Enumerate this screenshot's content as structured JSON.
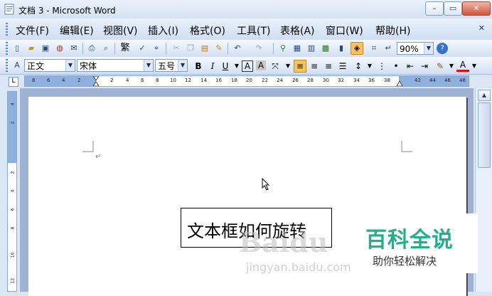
{
  "window": {
    "title": "文档 3 - Microsoft Word"
  },
  "menus": [
    "文件(F)",
    "编辑(E)",
    "视图(V)",
    "插入(I)",
    "格式(O)",
    "工具(T)",
    "表格(A)",
    "窗口(W)",
    "帮助(H)"
  ],
  "standard_toolbar": {
    "zoom": "90%"
  },
  "format_toolbar": {
    "style": "正文",
    "font": "宋体",
    "size": "五号",
    "bold": "B",
    "italic": "I",
    "underline": "U",
    "char_border": "A",
    "char_shading": "A",
    "font_color": "A"
  },
  "ruler_h_labels": [
    "8",
    "6",
    "4",
    "2",
    "",
    "2",
    "4",
    "6",
    "8",
    "10",
    "12",
    "14",
    "16",
    "18",
    "20",
    "22",
    "24",
    "26",
    "28",
    "30",
    "32",
    "34",
    "36",
    "38",
    "",
    "42",
    "44",
    "46",
    "48"
  ],
  "ruler_v_labels": [
    "4",
    "2",
    "",
    "2",
    "4",
    "6",
    "8",
    "10",
    "12"
  ],
  "document": {
    "textbox_text": "文本框如何旋转"
  },
  "watermark": {
    "baidu": "Baidu",
    "site": "jingyan.baidu.com",
    "badge_title": "百科全说",
    "badge_subtitle": "助你轻松解决"
  },
  "colors": {
    "accent": "#22b08b",
    "ruler_margin": "#8fb1e0",
    "workspace": "#9db2d5"
  }
}
